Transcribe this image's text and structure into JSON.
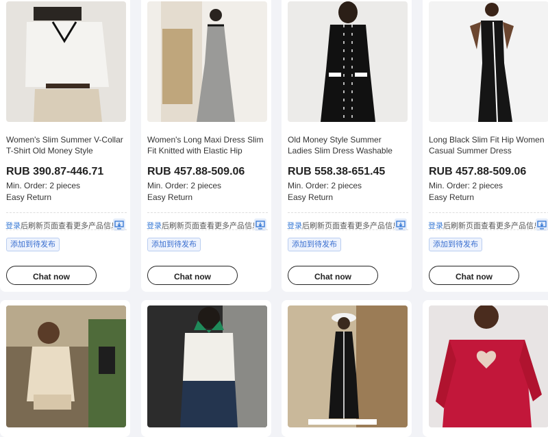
{
  "products": [
    {
      "title": "Women's Slim Summer V-Collar T-Shirt Old Money Style Contrast…",
      "price": "RUB 390.87-446.71",
      "min_order": "Min. Order: 2 pieces",
      "easy_return": "Easy Return",
      "login_link": "登录",
      "login_note": "后刷新页面查看更多产品信息",
      "tag": "添加到待发布",
      "chat_label": "Chat now"
    },
    {
      "title": "Women's Long Maxi Dress Slim Fit Knitted with Elastic Hip Skirt…",
      "price": "RUB 457.88-509.06",
      "min_order": "Min. Order: 2 pieces",
      "easy_return": "Easy Return",
      "login_link": "登录",
      "login_note": "后刷新页面查看更多产品信息",
      "tag": "添加到待发布",
      "chat_label": "Chat now"
    },
    {
      "title": "Old Money Style Summer Ladies Slim Dress Washable Casual…",
      "price": "RUB 558.38-651.45",
      "min_order": "Min. Order: 2 pieces",
      "easy_return": "Easy Return",
      "login_link": "登录",
      "login_note": "后刷新页面查看更多产品信息",
      "tag": "添加到待发布",
      "chat_label": "Chat now"
    },
    {
      "title": "Long Black Slim Fit Hip Women Casual Summer Dress Stretch…",
      "price": "RUB 457.88-509.06",
      "min_order": "Min. Order: 2 pieces",
      "easy_return": "Easy Return",
      "login_link": "登录",
      "login_note": "后刷新页面查看更多产品信息",
      "tag": "添加到待发布",
      "chat_label": "Chat now"
    }
  ],
  "icons": {
    "share": "share-screen-icon"
  },
  "colors": {
    "accent_blue": "#3a7bd5",
    "tag_bg": "#eef3fd",
    "page_bg": "#f2f3f7"
  }
}
